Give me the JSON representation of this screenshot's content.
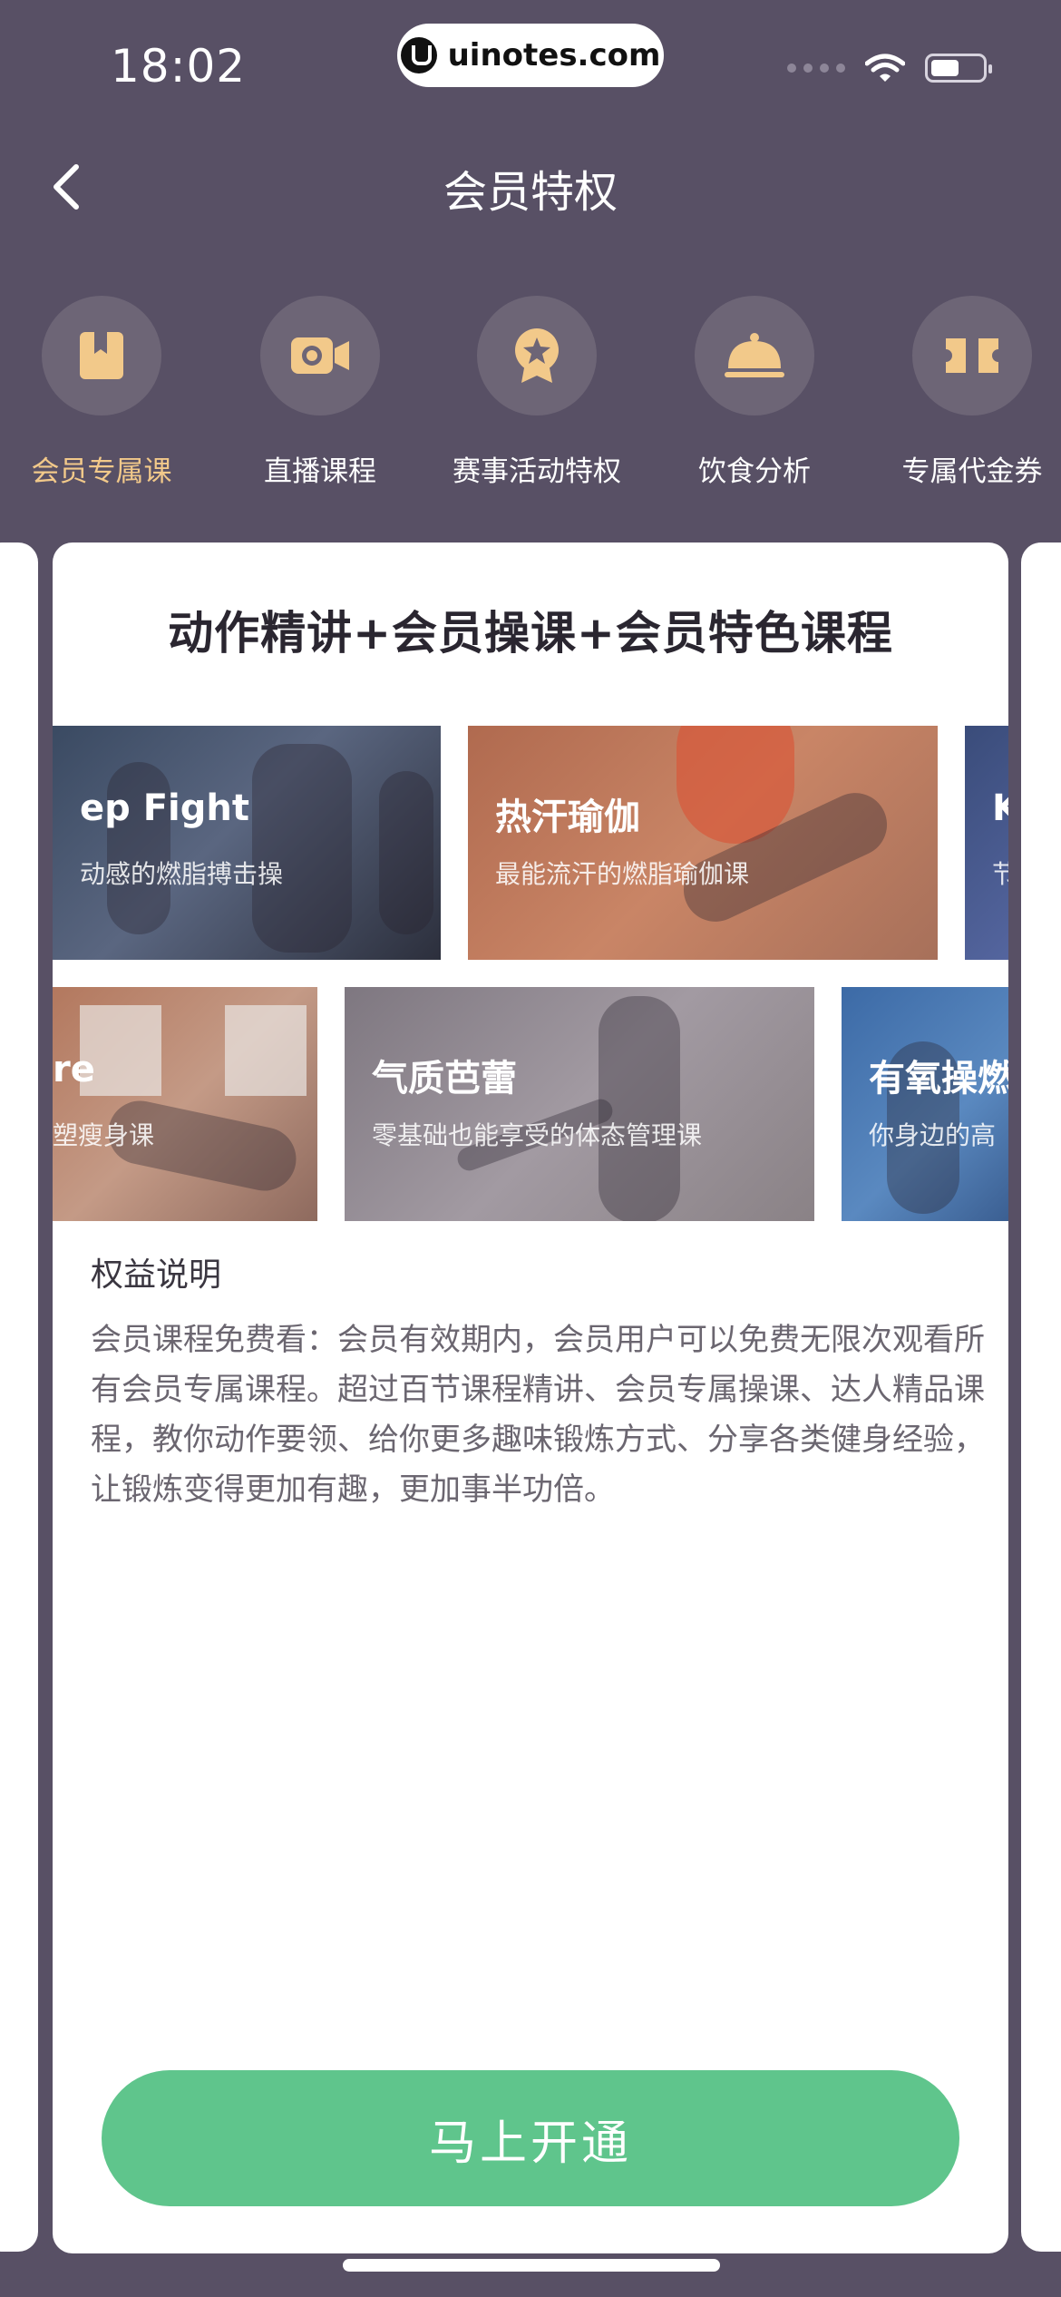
{
  "status_bar": {
    "time": "18:02",
    "url": "uinotes.com"
  },
  "nav": {
    "title": "会员特权"
  },
  "tabs": [
    {
      "label": "会员专属课",
      "icon": "bookmark-book-icon",
      "active": true
    },
    {
      "label": "直播课程",
      "icon": "video-camera-icon",
      "active": false
    },
    {
      "label": "赛事活动特权",
      "icon": "medal-badge-icon",
      "active": false
    },
    {
      "label": "饮食分析",
      "icon": "food-cloche-icon",
      "active": false
    },
    {
      "label": "专属代金券",
      "icon": "ticket-coupon-icon",
      "active": false
    }
  ],
  "colors": {
    "background": "#585065",
    "accent_gold": "#f2c98a",
    "cta_green": "#5fc58c"
  },
  "card": {
    "title": "动作精讲+会员操课+会员特色课程",
    "row1": [
      {
        "title": "ep Fight",
        "subtitle": "动感的燃脂搏击操"
      },
      {
        "title": "热汗瑜伽",
        "subtitle": "最能流汗的燃脂瑜伽课"
      },
      {
        "title": "K",
        "subtitle": "节"
      }
    ],
    "row2": [
      {
        "title": "re",
        "subtitle": "塑瘦身课"
      },
      {
        "title": "气质芭蕾",
        "subtitle": "零基础也能享受的体态管理课"
      },
      {
        "title": "有氧操燃",
        "subtitle": "你身边的高"
      }
    ],
    "benefit_label": "权益说明",
    "benefit_text": "会员课程免费看：会员有效期内，会员用户可以免费无限次观看所有会员专属课程。超过百节课程精讲、会员专属操课、达人精品课程，教你动作要领、给你更多趣味锻炼方式、分享各类健身经验，让锻炼变得更加有趣，更加事半功倍。",
    "cta_label": "马上开通"
  }
}
